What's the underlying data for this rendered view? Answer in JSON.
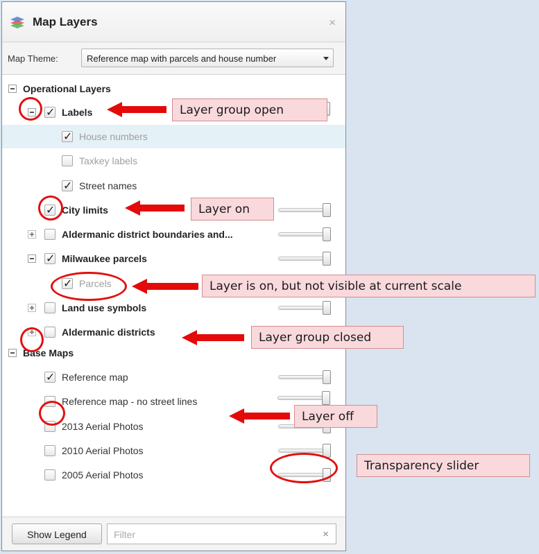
{
  "panel": {
    "title": "Map Layers",
    "close_symbol": "×",
    "theme_label": "Map Theme:",
    "theme_value": "Reference map with parcels and house number",
    "icon": "layers-icon"
  },
  "tree": {
    "operational_layers": "Operational Layers",
    "labels": "Labels",
    "house_numbers": "House numbers",
    "taxkey_labels": "Taxkey labels",
    "street_names": "Street names",
    "city_limits": "City limits",
    "aldermanic_boundaries": "Aldermanic district boundaries and...",
    "milwaukee_parcels": "Milwaukee parcels",
    "parcels": "Parcels",
    "land_use_symbols": "Land use symbols",
    "aldermanic_districts": "Aldermanic districts",
    "base_maps": "Base Maps",
    "reference_map": "Reference map",
    "reference_map_no_street": "Reference map - no street lines",
    "aerial_2013": "2013 Aerial Photos",
    "aerial_2010": "2010 Aerial Photos",
    "aerial_2005": "2005 Aerial Photos"
  },
  "bottom": {
    "show_legend": "Show Legend",
    "filter_placeholder": "Filter",
    "clear_symbol": "×"
  },
  "callouts": {
    "group_open": "Layer group open",
    "layer_on": "Layer on",
    "not_visible": "Layer is on, but not visible at current scale",
    "group_closed": "Layer group closed",
    "layer_off": "Layer off",
    "transparency": "Transparency slider"
  },
  "colors": {
    "callout_bg": "#f9d9dc",
    "arrow_red": "#e40a0a",
    "highlight_row": "#e4f1f6"
  }
}
